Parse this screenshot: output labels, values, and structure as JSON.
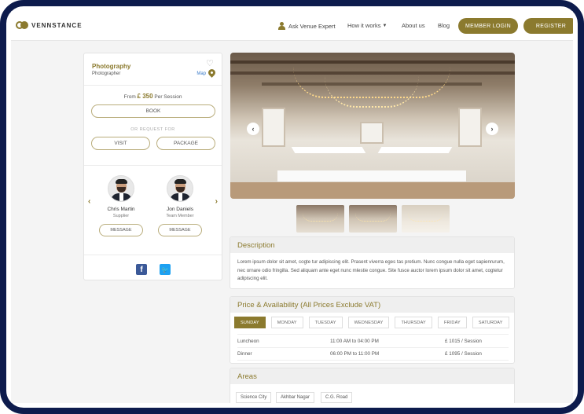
{
  "header": {
    "logo_text": "VENNSTANCE",
    "nav": {
      "ask_expert": "Ask Venue Expert",
      "how_it_works": "How it works",
      "about": "About us",
      "blog": "Blog"
    },
    "member_login": "MEMBER LOGIN",
    "register": "REGISTER",
    "accent_color": "#8b7a2e"
  },
  "sidebar": {
    "title": "Photography",
    "subtitle": "Photographer",
    "map_label": "Map",
    "price_prefix": "From",
    "price_value": "£ 350",
    "price_suffix": "Per Session",
    "book_label": "BOOK",
    "or_request": "OR REQUEST FOR",
    "visit_label": "VISIT",
    "package_label": "PACKAGE",
    "members": [
      {
        "name": "Chris Martin",
        "role": "Supplier",
        "message_label": "MESSAGE"
      },
      {
        "name": "Jon Daniels",
        "role": "Team Member",
        "message_label": "MESSAGE"
      }
    ],
    "social": [
      "facebook-icon",
      "twitter-icon"
    ]
  },
  "gallery": {
    "thumbnails": 3
  },
  "description": {
    "heading": "Description",
    "text": "Lorem ipsum dolor sit amet, cogte tur adipiscing elit. Prasent viverra eges tas pretium. Nunc congue nulla eget sapienrurum, nec ornare odio fringilla. Sed aliquam ante eget nunc mlestie congue. Site fusce auctor lorem ipsum dolor sit amet, cogtetur adipiscing elit."
  },
  "pricing": {
    "heading": "Price & Availability (All Prices Exclude VAT)",
    "days": [
      "SUNDAY",
      "MONDAY",
      "TUESDAY",
      "WEDNESDAY",
      "THURSDAY",
      "FRIDAY",
      "SATURDAY"
    ],
    "active_day": "SUNDAY",
    "rows": [
      {
        "meal": "Luncheon",
        "time": "11:00 AM to 04:00 PM",
        "price": "£ 1015 / Session"
      },
      {
        "meal": "Dinner",
        "time": "06:00 PM to 11:00 PM",
        "price": "£ 1095 / Session"
      }
    ]
  },
  "areas": {
    "heading": "Areas",
    "tags": [
      "Science City",
      "Akhbar Nagar",
      "C.G. Road"
    ]
  }
}
